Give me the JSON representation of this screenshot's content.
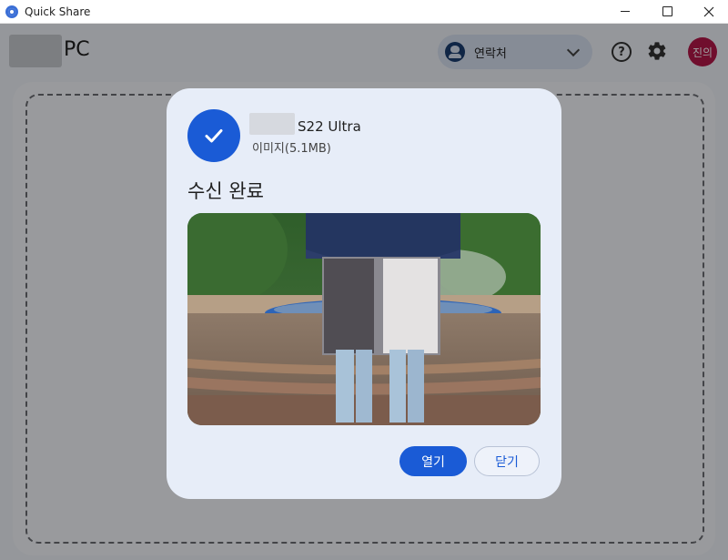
{
  "window": {
    "title": "Quick Share"
  },
  "header": {
    "device_name": "PC",
    "contacts_label": "연락처",
    "avatar_initials": "진의"
  },
  "dialog": {
    "sender_device": "S22 Ultra",
    "file_info": "이미지(5.1MB)",
    "status_title": "수신 완료",
    "open_button": "열기",
    "close_button": "닫기"
  },
  "colors": {
    "accent": "#1a5bd6",
    "avatar_bg": "#b5174a",
    "dialog_bg": "#e7edf8"
  },
  "icons": [
    "quick-share-icon",
    "person-icon",
    "chevron-down-icon",
    "help-icon",
    "gear-icon",
    "checkmark-icon"
  ]
}
